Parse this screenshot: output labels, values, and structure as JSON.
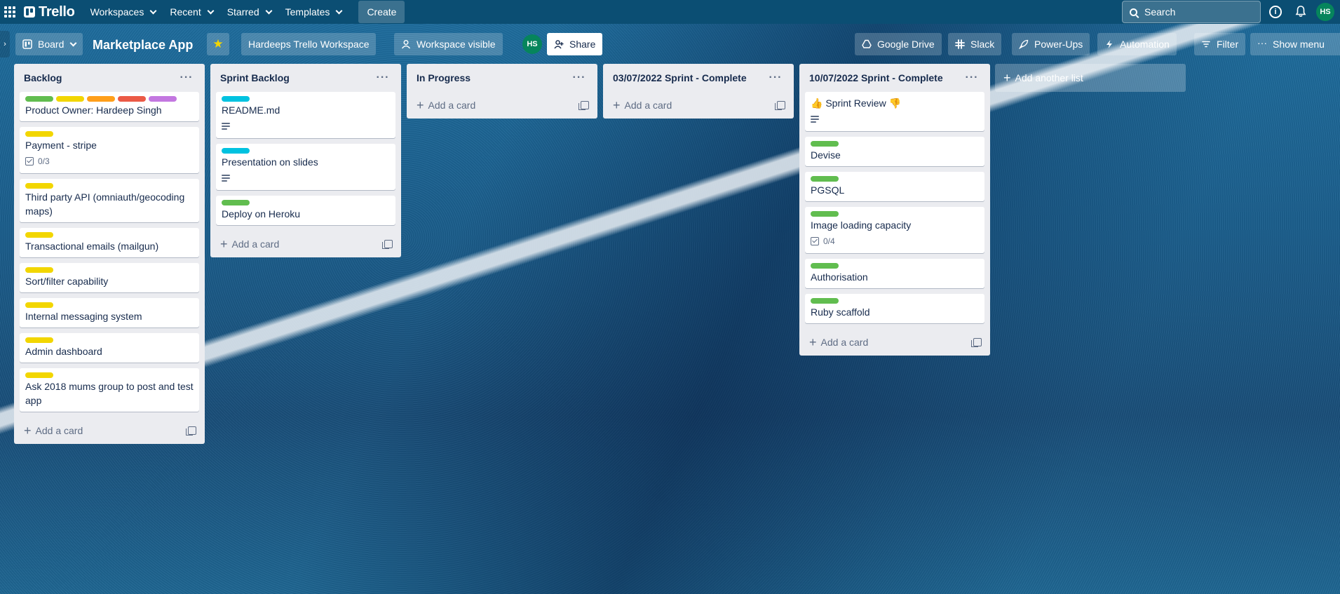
{
  "topnav": {
    "logo": "Trello",
    "menus": [
      "Workspaces",
      "Recent",
      "Starred",
      "Templates"
    ],
    "create_label": "Create",
    "search_placeholder": "Search",
    "user_initials": "HS"
  },
  "board_header": {
    "view_label": "Board",
    "title": "Marketplace App",
    "workspace_label": "Hardeeps Trello Workspace",
    "visibility_label": "Workspace visible",
    "member_initials": "HS",
    "share_label": "Share",
    "google_drive_label": "Google Drive",
    "slack_label": "Slack",
    "powerups_label": "Power-Ups",
    "automation_label": "Automation",
    "filter_label": "Filter",
    "show_menu_label": "Show menu"
  },
  "colors": {
    "green": "#61bd4f",
    "yellow": "#f2d600",
    "orange": "#ff9f1a",
    "red": "#eb5a46",
    "purple": "#c377e0",
    "sky": "#00c2e0"
  },
  "lists": [
    {
      "title": "Backlog",
      "add_card": "Add a card",
      "cards": [
        {
          "title": "Product Owner: Hardeep Singh",
          "labels": [
            "green",
            "yellow",
            "orange",
            "red",
            "purple"
          ]
        },
        {
          "title": "Payment - stripe",
          "labels": [
            "yellow"
          ],
          "checklist": "0/3"
        },
        {
          "title": "Third party API (omniauth/geocoding maps)",
          "labels": [
            "yellow"
          ]
        },
        {
          "title": "Transactional emails (mailgun)",
          "labels": [
            "yellow"
          ]
        },
        {
          "title": "Sort/filter capability",
          "labels": [
            "yellow"
          ]
        },
        {
          "title": "Internal messaging system",
          "labels": [
            "yellow"
          ]
        },
        {
          "title": "Admin dashboard",
          "labels": [
            "yellow"
          ]
        },
        {
          "title": "Ask 2018 mums group to post and test app",
          "labels": [
            "yellow"
          ]
        }
      ]
    },
    {
      "title": "Sprint Backlog",
      "add_card": "Add a card",
      "cards": [
        {
          "title": "README.md",
          "labels": [
            "sky"
          ],
          "description": true
        },
        {
          "title": "Presentation on slides",
          "labels": [
            "sky"
          ],
          "description": true
        },
        {
          "title": "Deploy on Heroku",
          "labels": [
            "green"
          ]
        }
      ]
    },
    {
      "title": "In Progress",
      "add_card": "Add a card",
      "cards": []
    },
    {
      "title": "03/07/2022 Sprint - Complete",
      "add_card": "Add a card",
      "cards": []
    },
    {
      "title": "10/07/2022 Sprint - Complete",
      "add_card": "Add a card",
      "cards": [
        {
          "title": "👍 Sprint Review 👎",
          "labels": [],
          "description": true
        },
        {
          "title": "Devise",
          "labels": [
            "green"
          ]
        },
        {
          "title": "PGSQL",
          "labels": [
            "green"
          ]
        },
        {
          "title": "Image loading capacity",
          "labels": [
            "green"
          ],
          "checklist": "0/4"
        },
        {
          "title": "Authorisation",
          "labels": [
            "green"
          ]
        },
        {
          "title": "Ruby scaffold",
          "labels": [
            "green"
          ]
        }
      ]
    }
  ],
  "add_list_label": "Add another list"
}
